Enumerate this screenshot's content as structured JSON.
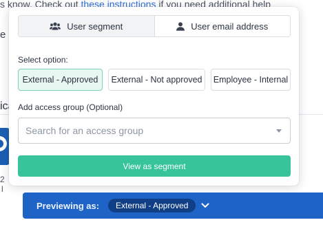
{
  "background": {
    "top_text_before": "s know. Check out ",
    "top_text_link": "these instructions",
    "top_text_after": " if you need additional help",
    "left_fragment_e": "e",
    "left_fragment_ica": "ica",
    "left_small_2": "2",
    "left_small_l": "l"
  },
  "popup": {
    "tabs": [
      {
        "label": "User segment",
        "icon": "users-icon",
        "active": true
      },
      {
        "label": "User email address",
        "icon": "user-icon",
        "active": false
      }
    ],
    "select_option_label": "Select option:",
    "options": [
      {
        "label": "External - Approved",
        "selected": true
      },
      {
        "label": "External - Not approved",
        "selected": false
      },
      {
        "label": "Employee - Internal",
        "selected": false
      }
    ],
    "access_group_label": "Add access group (Optional)",
    "access_group_placeholder": "Search for an access group",
    "submit_label": "View as segment"
  },
  "preview_bar": {
    "label": "Previewing as:",
    "value": "External - Approved"
  },
  "colors": {
    "accent_green": "#37c49a",
    "preview_blue": "#1e63c6",
    "pill_navy": "#103f86",
    "link_blue": "#2f6fd6"
  }
}
